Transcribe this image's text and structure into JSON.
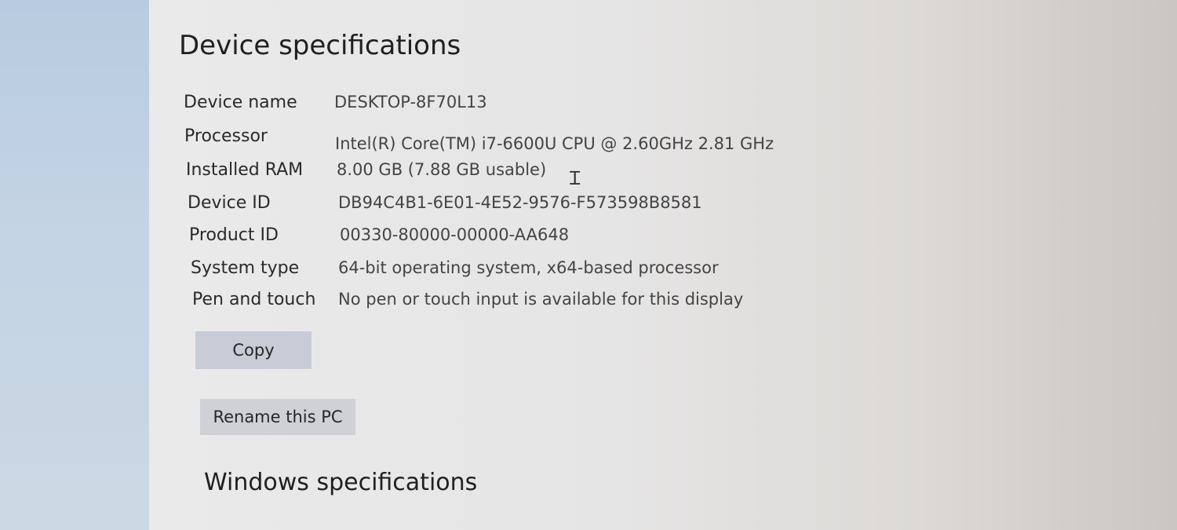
{
  "device_specs": {
    "title": "Device specifications",
    "rows": [
      {
        "label": "Device name",
        "value": "DESKTOP-8F70L13"
      },
      {
        "label": "Processor",
        "value": "Intel(R) Core(TM) i7-6600U CPU @ 2.60GHz   2.81 GHz"
      },
      {
        "label": "Installed RAM",
        "value": "8.00 GB (7.88 GB usable)"
      },
      {
        "label": "Device ID",
        "value": "DB94C4B1-6E01-4E52-9576-F573598B8581"
      },
      {
        "label": "Product ID",
        "value": "00330-80000-00000-AA648"
      },
      {
        "label": "System type",
        "value": "64-bit operating system, x64-based processor"
      },
      {
        "label": "Pen and touch",
        "value": "No pen or touch input is available for this display"
      }
    ],
    "copy_label": "Copy",
    "rename_label": "Rename this PC"
  },
  "windows_specs": {
    "title": "Windows specifications"
  },
  "icons": {
    "text_cursor": "text-cursor-icon"
  }
}
